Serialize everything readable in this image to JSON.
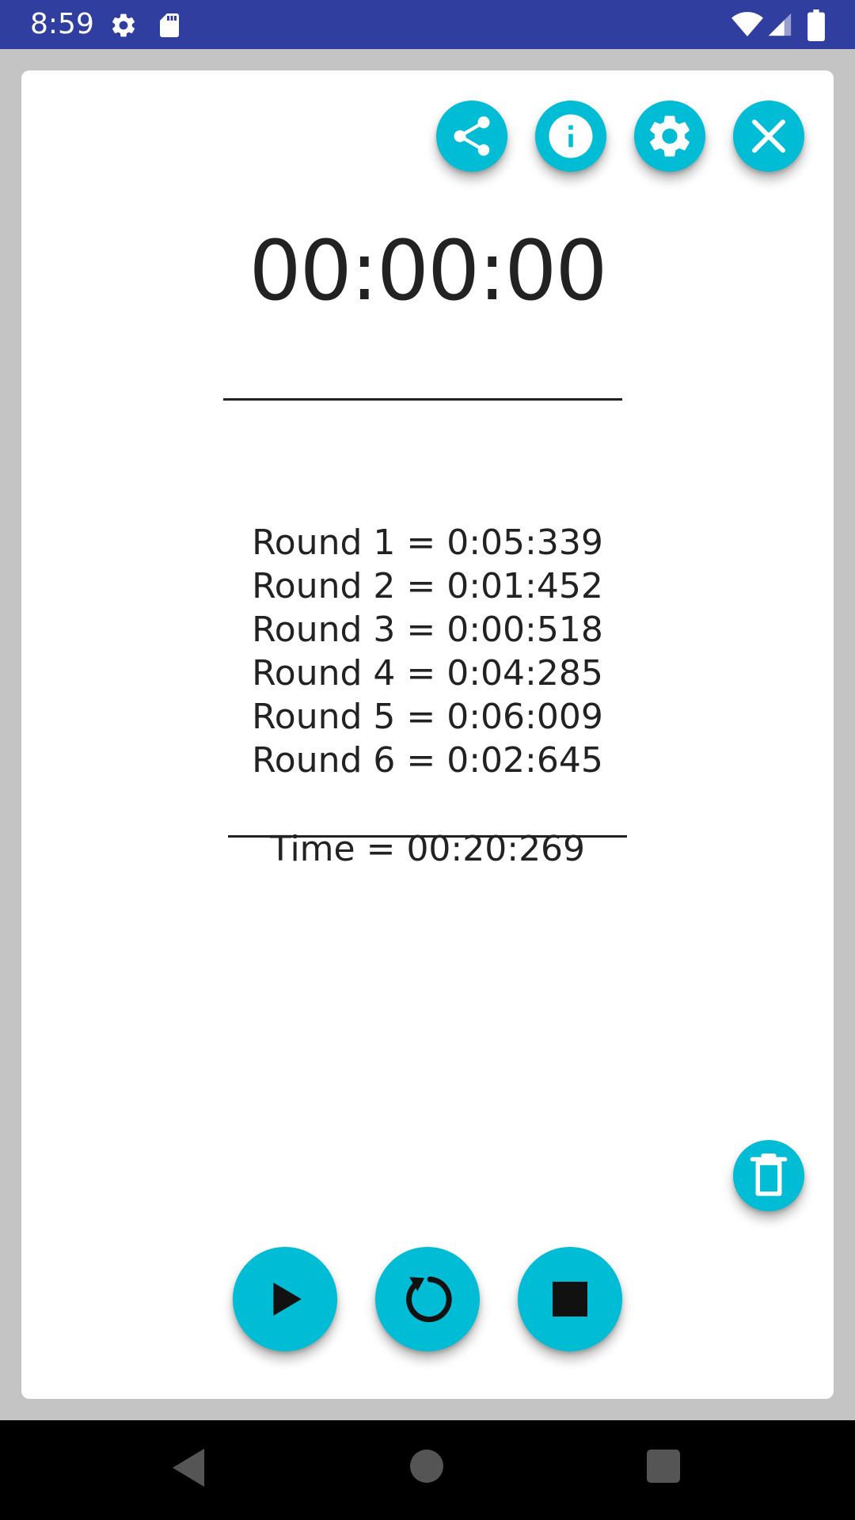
{
  "status_bar": {
    "time": "8:59",
    "icons": [
      "gear-icon",
      "sd-card-icon",
      "wifi-icon",
      "signal-icon",
      "battery-icon"
    ]
  },
  "toolbar": {
    "actions": [
      "share-icon",
      "info-icon",
      "settings-icon",
      "close-icon"
    ]
  },
  "stopwatch": {
    "display": "00:00:00",
    "rounds": [
      "Round 1 = 0:05:339",
      "Round 2 = 0:01:452",
      "Round 3 = 0:00:518",
      "Round 4 = 0:04:285",
      "Round 5 = 0:06:009",
      "Round 6 = 0:02:645"
    ],
    "total": "Time = 00:20:269"
  },
  "controls": [
    "play-icon",
    "reset-icon",
    "stop-icon",
    "delete-icon"
  ],
  "colors": {
    "accent": "#00bcd4",
    "status_bar": "#303f9f",
    "text": "#222222",
    "background": "#c4c4c4"
  }
}
